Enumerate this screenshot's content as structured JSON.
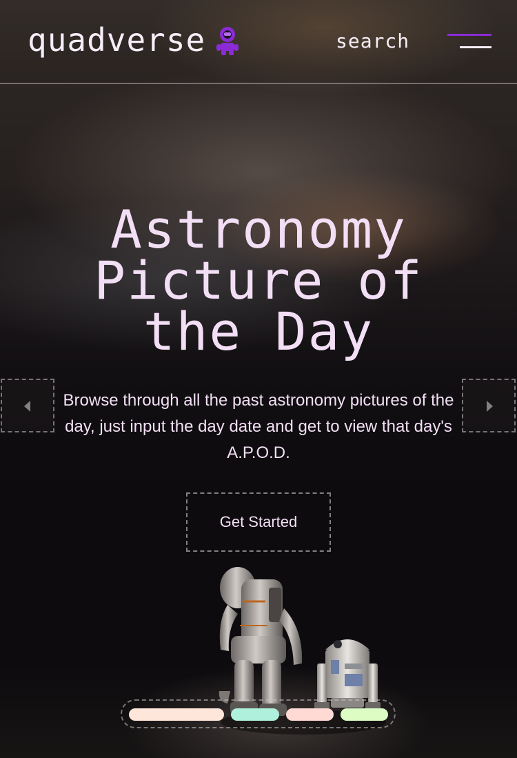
{
  "header": {
    "logo_text": "quadverse",
    "logo_icon": "astronaut-icon",
    "search_label": "search",
    "menu_icon": "hamburger-menu-icon"
  },
  "hero": {
    "title": "Astronomy Picture of the Day",
    "description": "Browse through all the past astronomy pictures of the day, just input the day date and get to view that day's A.P.O.D.",
    "cta_label": "Get Started",
    "prev_icon": "arrow-left-icon",
    "next_icon": "arrow-right-icon"
  },
  "illustration": {
    "icon": "astronaut-and-droid-illustration"
  },
  "pagination": {
    "dots": [
      {
        "color": "#ffe6da",
        "active": true
      },
      {
        "color": "#aef0dc",
        "active": false
      },
      {
        "color": "#ffd9d4",
        "active": false
      },
      {
        "color": "#dcfcc4",
        "active": false
      }
    ]
  },
  "colors": {
    "accent": "#8a2bd6",
    "text": "#f3dff5",
    "background": "#0d0b0e"
  }
}
